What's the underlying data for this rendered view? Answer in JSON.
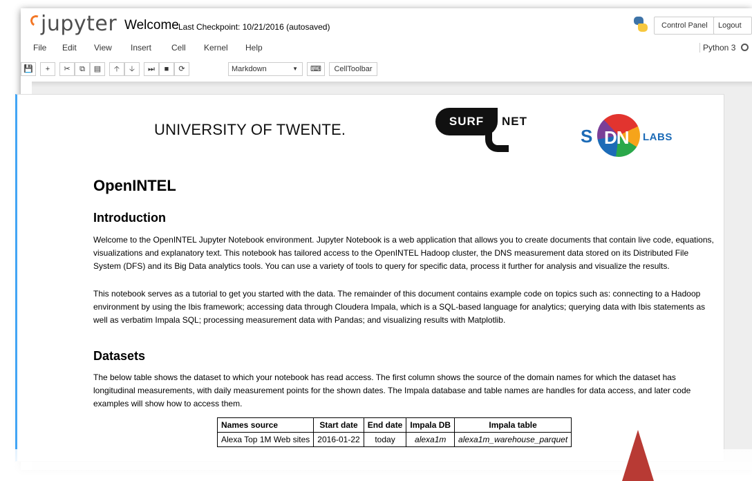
{
  "header": {
    "logo_text": "jupyter",
    "notebook_title": "Welcome",
    "checkpoint": "Last Checkpoint: 10/21/2016 (autosaved)",
    "control_panel_label": "Control Panel",
    "logout_label": "Logout"
  },
  "menubar": {
    "items": [
      "File",
      "Edit",
      "View",
      "Insert",
      "Cell",
      "Kernel",
      "Help"
    ],
    "kernel_name": "Python 3"
  },
  "toolbar": {
    "icons": [
      "save-icon",
      "plus-icon",
      "cut-icon",
      "copy-icon",
      "paste-icon",
      "arrow-up-icon",
      "arrow-down-icon",
      "skip-next-icon",
      "stop-icon",
      "restart-icon"
    ],
    "cell_type": "Markdown",
    "celltoolbar_label": "CellToolbar"
  },
  "logos": {
    "ut": "UNIVERSITY OF TWENTE.",
    "surf": "SURF",
    "net": "NET",
    "sidn_s": "S",
    "sidn_dn": "DN",
    "sidn_labs": "LABS"
  },
  "content": {
    "title": "OpenINTEL",
    "intro_heading": "Introduction",
    "intro_p1": "Welcome to the OpenINTEL Jupyter Notebook environment. Jupyter Notebook is a web application that allows you to create documents that contain live code, equations, visualizations and explanatory text. This notebook has tailored access to the OpenINTEL Hadoop cluster, the DNS measurement data stored on its Distributed File System (DFS) and its Big Data analytics tools. You can use a variety of tools to query for specific data, process it further for analysis and visualize the results.",
    "intro_p2": "This notebook serves as a tutorial to get you started with the data. The remainder of this document contains example code on topics such as: connecting to a Hadoop environment by using the Ibis framework; accessing data through Cloudera Impala, which is a SQL-based language for analytics; querying data with Ibis statements as well as verbatim Impala SQL; processing measurement data with Pandas; and visualizing results with Matplotlib.",
    "datasets_heading": "Datasets",
    "datasets_p": "The below table shows the dataset to which your notebook has read access. The first column shows the source of the domain names for which the dataset has longitudinal measurements, with daily measurement points for the shown dates. The Impala database and table names are handles for data access, and later code examples will show how to access them."
  },
  "table": {
    "headers": [
      "Names source",
      "Start date",
      "End date",
      "Impala DB",
      "Impala table"
    ],
    "rows": [
      [
        "Alexa Top 1M Web sites",
        "2016-01-22",
        "today",
        "alexa1m",
        "alexa1m_warehouse_parquet"
      ]
    ]
  },
  "colors": {
    "jupyter_orange": "#f37726",
    "cell_selected_border": "#42a5f5",
    "annotation_arrow": "#c0392b"
  }
}
